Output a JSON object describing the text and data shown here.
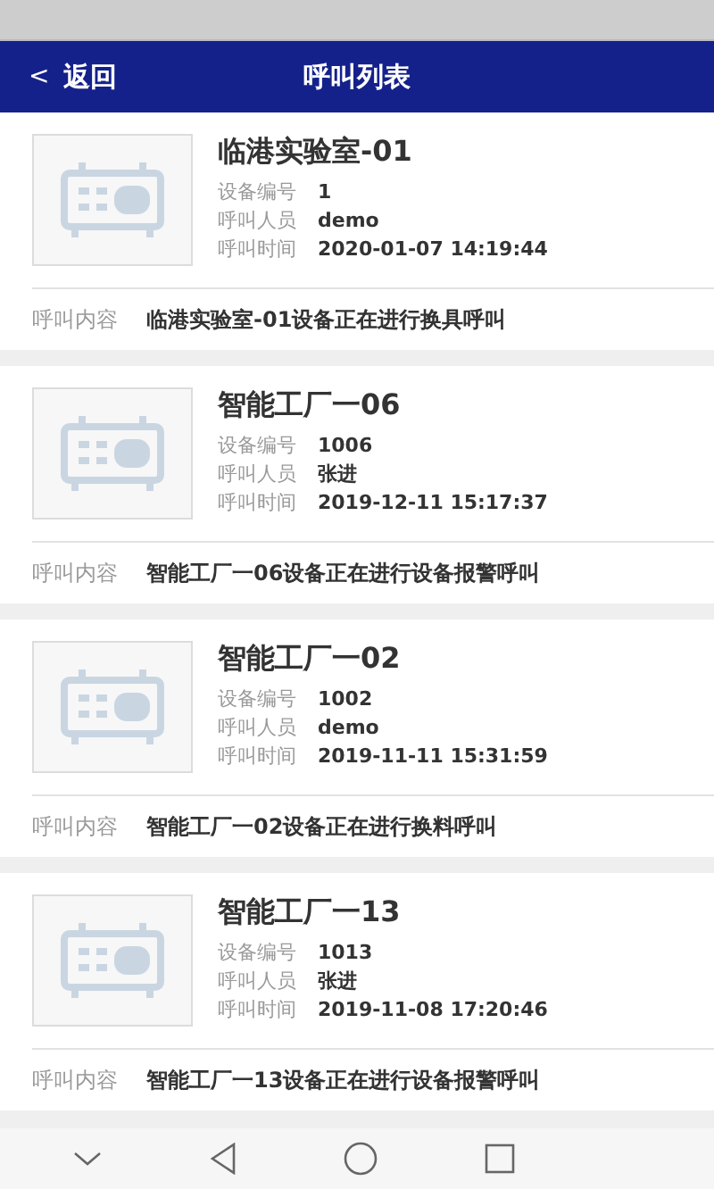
{
  "header": {
    "back_icon": "<",
    "back_label": "返回",
    "title": "呼叫列表"
  },
  "calls": [
    {
      "kind": "picture",
      "name": "临港实验室-01",
      "fields": [
        {
          "label": "设备编号",
          "value": "1"
        },
        {
          "label": "呼叫人员",
          "value": "demo"
        },
        {
          "label": "呼叫时间",
          "value": "2020-01-07 14:19:44"
        }
      ],
      "content_label": "呼叫内容",
      "content": "临港实验室-01设备正在进行换具呼叫"
    },
    {
      "kind": "picture",
      "name": "智能工厂一06",
      "fields": [
        {
          "label": "设备编号",
          "value": "1006"
        },
        {
          "label": "呼叫人员",
          "value": "张进"
        },
        {
          "label": "呼叫时间",
          "value": "2019-12-11 15:17:37"
        }
      ],
      "content_label": "呼叫内容",
      "content": "智能工厂一06设备正在进行设备报警呼叫"
    },
    {
      "kind": "picture",
      "name": "智能工厂一02",
      "fields": [
        {
          "label": "设备编号",
          "value": "1002"
        },
        {
          "label": "呼叫人员",
          "value": "demo"
        },
        {
          "label": "呼叫时间",
          "value": "2019-11-11 15:31:59"
        }
      ],
      "content_label": "呼叫内容",
      "content": "智能工厂一02设备正在进行换料呼叫"
    },
    {
      "kind": "picture",
      "name": "智能工厂一13",
      "fields": [
        {
          "label": "设备编号",
          "value": "1013"
        },
        {
          "label": "呼叫人员",
          "value": "张进"
        },
        {
          "label": "呼叫时间",
          "value": "2019-11-08 17:20:46"
        }
      ],
      "content_label": "呼叫内容",
      "content": "智能工厂一13设备正在进行设备报警呼叫"
    }
  ]
}
